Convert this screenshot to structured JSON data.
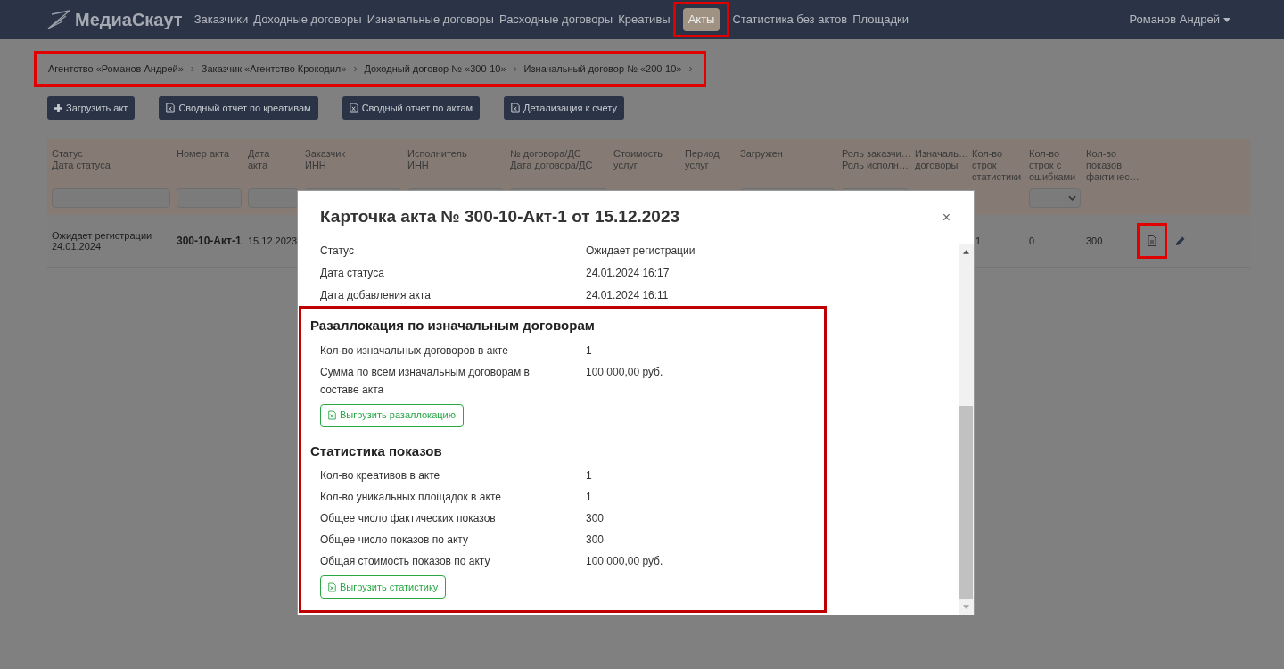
{
  "nav": {
    "brand": "МедиаСкаут",
    "user": "Романов Андрей",
    "items": [
      {
        "label": "Заказчики",
        "selected": false,
        "highlighted": false
      },
      {
        "label": "Доходные договоры",
        "selected": false,
        "highlighted": false
      },
      {
        "label": "Изначальные договоры",
        "selected": false,
        "highlighted": false
      },
      {
        "label": "Расходные договоры",
        "selected": false,
        "highlighted": false
      },
      {
        "label": "Креативы",
        "selected": false,
        "highlighted": false
      },
      {
        "label": "Акты",
        "selected": true,
        "highlighted": true
      },
      {
        "label": "Статистика без актов",
        "selected": false,
        "highlighted": false
      },
      {
        "label": "Площадки",
        "selected": false,
        "highlighted": false
      }
    ]
  },
  "breadcrumbs": {
    "highlighted": true,
    "separator": "›",
    "items": [
      "Агентство «Романов Андрей»",
      "Заказчик «Агентство Крокодил»",
      "Доходный договор № «300-10»",
      "Изначальный договор № «200-10»"
    ]
  },
  "toolbar": [
    {
      "label": "Загрузить акт",
      "kind": "plus"
    },
    {
      "label": "Сводный отчет по креативам",
      "kind": "excel"
    },
    {
      "label": "Сводный отчет по актам",
      "kind": "excel"
    },
    {
      "label": "Детализация к счету",
      "kind": "excel"
    }
  ],
  "table": {
    "columns": [
      {
        "lines": [
          "Статус",
          "Дата статуса"
        ],
        "kind": "input"
      },
      {
        "lines": [
          "Номер акта"
        ],
        "kind": "input"
      },
      {
        "lines": [
          "Дата",
          "акта"
        ],
        "kind": "input"
      },
      {
        "lines": [
          "Заказчик",
          "ИНН"
        ],
        "kind": "input"
      },
      {
        "lines": [
          "Исполнитель",
          "ИНН"
        ],
        "kind": "input"
      },
      {
        "lines": [
          "№ договора/ДС",
          "Дата договора/ДС"
        ],
        "kind": "input"
      },
      {
        "lines": [
          "Стоимость",
          "услуг"
        ],
        "kind": "plain"
      },
      {
        "lines": [
          "Период",
          "услуг"
        ],
        "kind": "plain"
      },
      {
        "lines": [
          "Загружен"
        ],
        "kind": "input"
      },
      {
        "lines": [
          "Роль заказчи…",
          "Роль исполн…"
        ],
        "kind": "input"
      },
      {
        "lines": [
          "Изначаль…",
          "договоры"
        ],
        "kind": "plain"
      },
      {
        "lines": [
          "Кол-во",
          "строк",
          "статистики"
        ],
        "kind": "plain"
      },
      {
        "lines": [
          "Кол-во",
          "строк с",
          "ошибками"
        ],
        "kind": "select"
      },
      {
        "lines": [
          "Кол-во",
          "показов",
          "фактичес…"
        ],
        "kind": "plain"
      }
    ],
    "rows": [
      {
        "cells": [
          "Ожидает регистрации\n24.01.2024",
          "300-10-Акт-1",
          "15.12.2023",
          "",
          "",
          "",
          "",
          "",
          "",
          "",
          "",
          "1",
          "0",
          "300"
        ],
        "view_highlighted": true
      }
    ]
  },
  "modal": {
    "title": "Карточка акта № 300-10-Акт-1 от 15.12.2023",
    "close": "×",
    "rows": [
      {
        "label": "Статус",
        "value": "Ожидает регистрации"
      },
      {
        "label": "Дата статуса",
        "value": "24.01.2024 16:17"
      },
      {
        "label": "Дата добавления акта",
        "value": "24.01.2024 16:11"
      }
    ],
    "sections_highlighted": true,
    "sections": [
      {
        "title": "Разаллокация по изначальным договорам",
        "rows": [
          {
            "label": "Кол-во изначальных договоров в акте",
            "value": "1"
          },
          {
            "label": "Сумма по всем изначальным договорам в составе акта",
            "value": "100 000,00 руб."
          }
        ],
        "button": "Выгрузить разаллокацию"
      },
      {
        "title": "Статистика показов",
        "rows": [
          {
            "label": "Кол-во креативов в акте",
            "value": "1"
          },
          {
            "label": "Кол-во уникальных площадок в акте",
            "value": "1"
          },
          {
            "label": "Общее число фактических показов",
            "value": "300"
          },
          {
            "label": "Общее число показов по акту",
            "value": "300"
          },
          {
            "label": "Общая стоимость показов по акту",
            "value": "100 000,00 руб."
          }
        ],
        "button": "Выгрузить статистику"
      }
    ]
  }
}
